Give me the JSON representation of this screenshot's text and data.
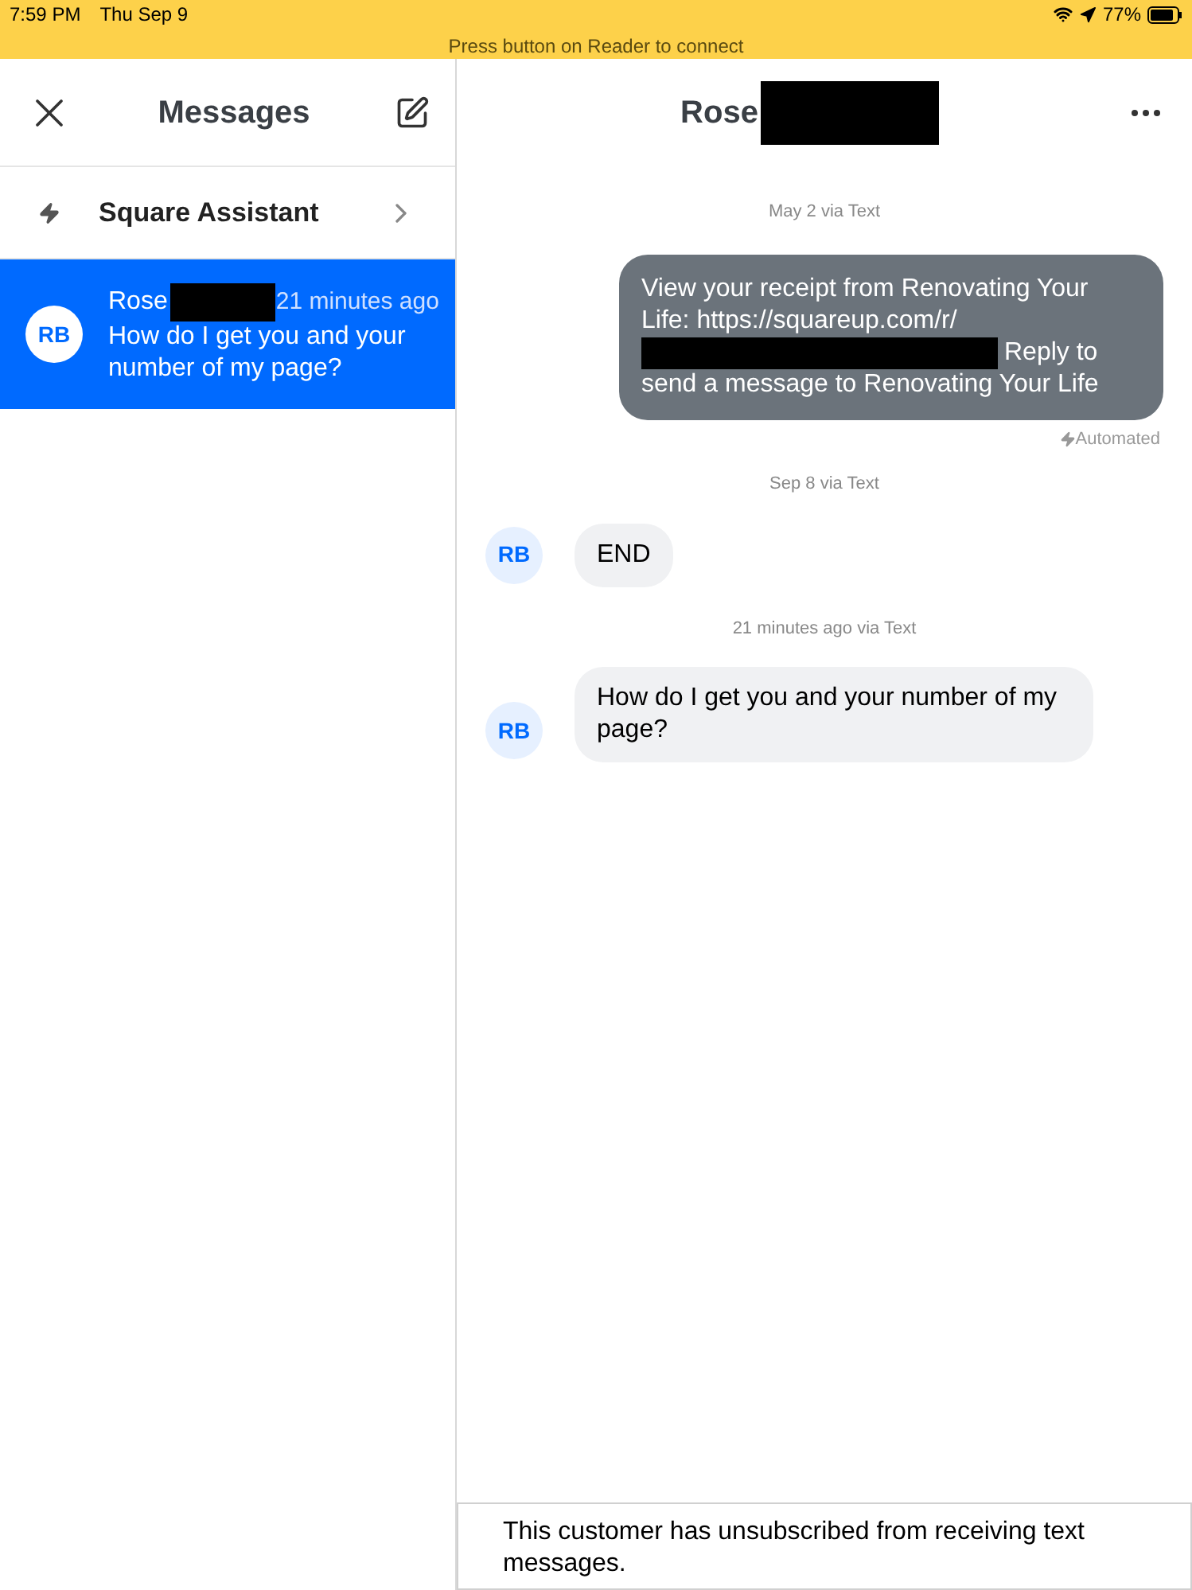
{
  "status_bar": {
    "time": "7:59 PM",
    "date": "Thu Sep 9",
    "battery": "77%"
  },
  "banner": "Press button on Reader to connect",
  "sidebar": {
    "title": "Messages",
    "assistant": "Square Assistant",
    "conversations": [
      {
        "initials": "RB",
        "name": "Rose",
        "redacted": true,
        "time": "21 minutes ago",
        "preview": "How do I get you and your number of my page?",
        "selected": true
      }
    ]
  },
  "chat": {
    "title": "Rose",
    "redacted": true,
    "items": [
      {
        "kind": "date",
        "text": "May 2 via Text"
      },
      {
        "kind": "outgoing",
        "before": "View your receipt from Renovating Your Life: https://squareup.com/r/",
        "after": "Reply to send a message to Renovating Your Life",
        "note": "Automated"
      },
      {
        "kind": "date",
        "text": "Sep 8 via Text"
      },
      {
        "kind": "incoming",
        "initials": "RB",
        "text": "END"
      },
      {
        "kind": "date",
        "text": "21 minutes ago via Text"
      },
      {
        "kind": "incoming",
        "initials": "RB",
        "text": "How do I get you and your number of my page?"
      }
    ],
    "notice": "This customer has unsubscribed from receiving text messages."
  }
}
